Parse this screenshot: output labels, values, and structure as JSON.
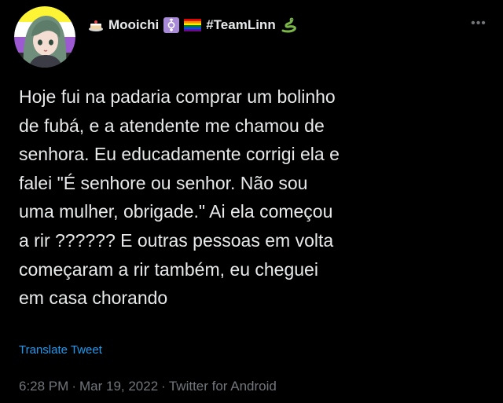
{
  "tweet": {
    "author": {
      "display_name": "Mooichi",
      "handle_tag": "#TeamLinn",
      "avatar": "avatar-image",
      "flag_colors": [
        "#fcf434",
        "#ffffff",
        "#9c59d1",
        "#2c2c2c"
      ]
    },
    "icons": {
      "leading": "cake-icon",
      "trans": "transgender-symbol-icon",
      "flag": "rainbow-flag-icon",
      "trailing": "snake-icon",
      "more": "more-options-icon"
    },
    "text": "Hoje fui na padaria comprar um bolinho\nde fubá, e a atendente me chamou de\nsenhora. Eu educadamente corrigi ela e\nfalei \"É senhore ou senhor. Não sou\numa mulher, obrigade.\" Ai ela começou\na rir ?????? E outras pessoas em volta\ncomeçaram a rir também, eu cheguei\nem casa chorando",
    "translate_label": "Translate Tweet",
    "time": "6:28 PM",
    "date": "Mar 19, 2022",
    "source": "Twitter for Android",
    "separator": "·"
  },
  "colors": {
    "background": "#000000",
    "text_primary": "#e7e9ea",
    "text_secondary": "#71767b",
    "link": "#1d9bf0"
  }
}
